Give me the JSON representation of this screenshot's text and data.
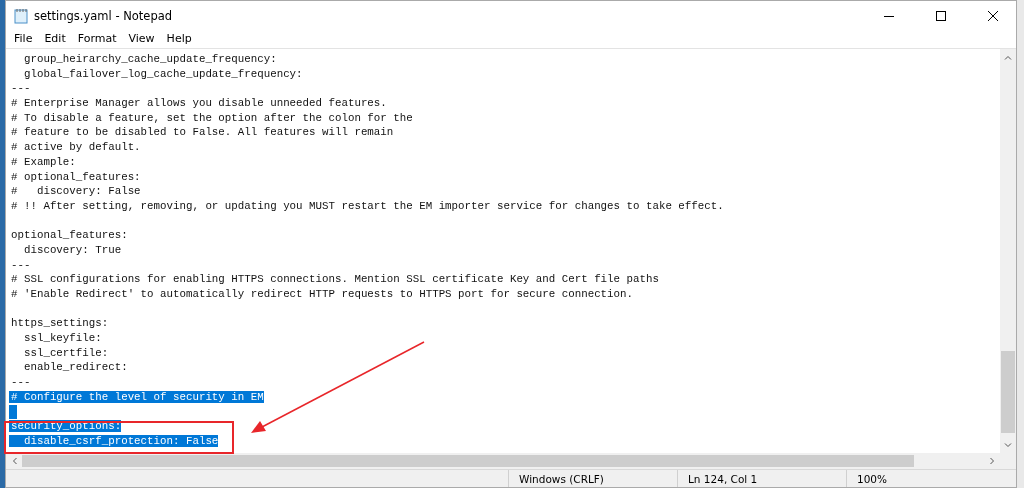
{
  "window": {
    "title": "settings.yaml - Notepad"
  },
  "menu": [
    "File",
    "Edit",
    "Format",
    "View",
    "Help"
  ],
  "editor": {
    "blocks": [
      {
        "lines": [
          {
            "text": "  group_heirarchy_cache_update_frequency:",
            "selected": false
          },
          {
            "text": "  global_failover_log_cache_update_frequency:",
            "selected": false
          },
          {
            "text": "---",
            "selected": false
          },
          {
            "text": "# Enterprise Manager allows you disable unneeded features.",
            "selected": false
          },
          {
            "text": "# To disable a feature, set the option after the colon for the",
            "selected": false
          },
          {
            "text": "# feature to be disabled to False. All features will remain",
            "selected": false
          },
          {
            "text": "# active by default.",
            "selected": false
          },
          {
            "text": "# Example:",
            "selected": false
          },
          {
            "text": "# optional_features:",
            "selected": false
          },
          {
            "text": "#   discovery: False",
            "selected": false
          },
          {
            "text": "# !! After setting, removing, or updating you MUST restart the EM importer service for changes to take effect.",
            "selected": false
          }
        ]
      },
      {
        "lines": [
          {
            "text": "optional_features:",
            "selected": false
          },
          {
            "text": "  discovery: True",
            "selected": false
          },
          {
            "text": "---",
            "selected": false
          },
          {
            "text": "# SSL configurations for enabling HTTPS connections. Mention SSL certificate Key and Cert file paths",
            "selected": false
          },
          {
            "text": "# 'Enable Redirect' to automatically redirect HTTP requests to HTTPS port for secure connection.",
            "selected": false
          }
        ]
      },
      {
        "lines": [
          {
            "text": "https_settings:",
            "selected": false
          },
          {
            "text": "  ssl_keyfile:",
            "selected": false
          },
          {
            "text": "  ssl_certfile:",
            "selected": false
          },
          {
            "text": "  enable_redirect:",
            "selected": false
          },
          {
            "text": "---",
            "selected": false
          },
          {
            "text": "# Configure the level of security in EM",
            "selected": true
          }
        ]
      },
      {
        "lines": [
          {
            "text": "security_options:",
            "selected": true
          },
          {
            "text": "  disable_csrf_protection: False",
            "selected": true
          }
        ]
      }
    ]
  },
  "status_bar": [
    "Windows (CRLF)",
    "Ln 124, Col 1",
    "100%"
  ]
}
